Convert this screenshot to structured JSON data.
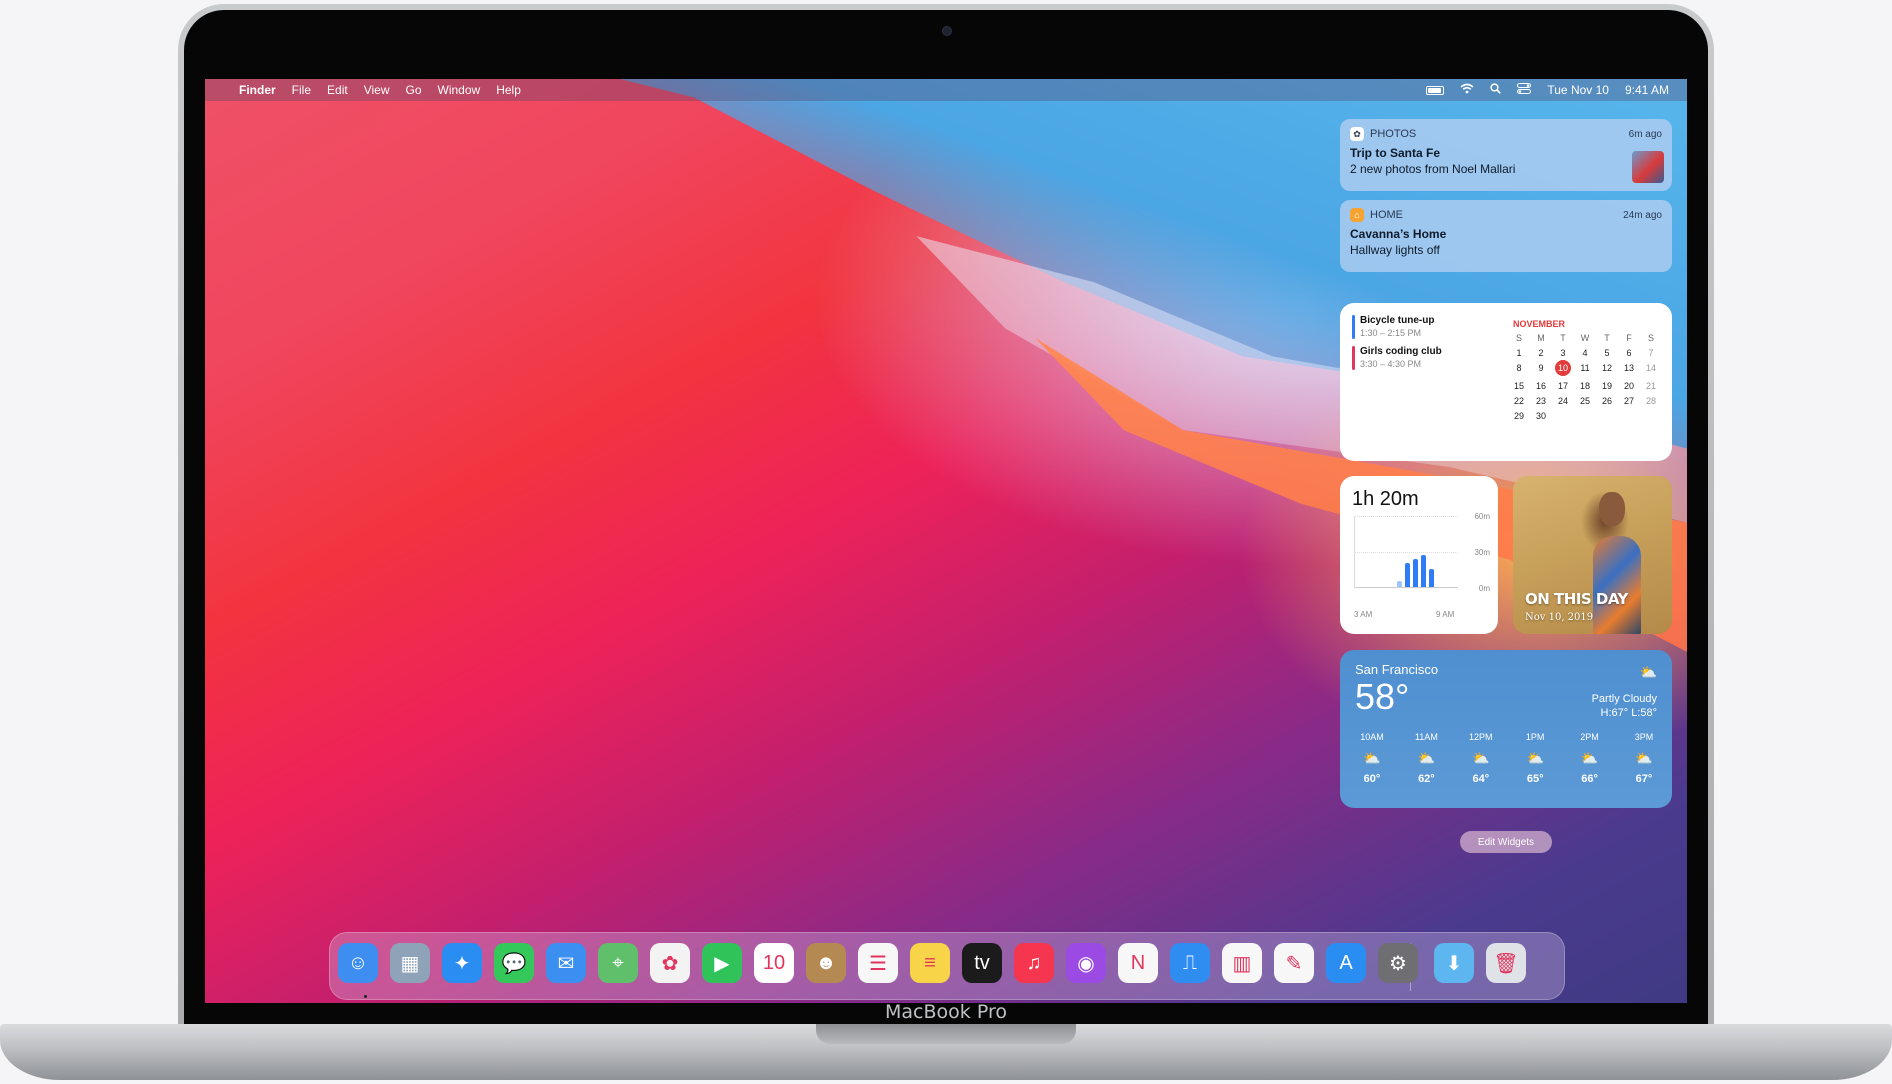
{
  "device_label": "MacBook Pro",
  "menubar": {
    "app_name": "Finder",
    "menus": [
      "File",
      "Edit",
      "View",
      "Go",
      "Window",
      "Help"
    ],
    "date": "Tue Nov 10",
    "time": "9:41 AM",
    "status_icons": [
      "battery-icon",
      "wifi-icon",
      "spotlight-icon",
      "control-center-icon"
    ]
  },
  "notifications": [
    {
      "app": "PHOTOS",
      "time": "6m ago",
      "title": "Trip to Santa Fe",
      "body": "2 new photos from Noel Mallari",
      "icon": "photos-icon"
    },
    {
      "app": "HOME",
      "time": "24m ago",
      "title": "Cavanna’s Home",
      "body": "Hallway lights off",
      "icon": "home-icon"
    }
  ],
  "calendar": {
    "events": [
      {
        "title": "Bicycle tune-up",
        "time": "1:30 – 2:15 PM",
        "color": "#2f7cf6"
      },
      {
        "title": "Girls coding club",
        "time": "3:30 – 4:30 PM",
        "color": "#e2355e"
      }
    ],
    "month": "NOVEMBER",
    "weekdays": [
      "S",
      "M",
      "T",
      "W",
      "T",
      "F",
      "S"
    ],
    "weeks": [
      [
        "1",
        "2",
        "3",
        "4",
        "5",
        "6",
        "7"
      ],
      [
        "8",
        "9",
        "10",
        "11",
        "12",
        "13",
        "14"
      ],
      [
        "15",
        "16",
        "17",
        "18",
        "19",
        "20",
        "21"
      ],
      [
        "22",
        "23",
        "24",
        "25",
        "26",
        "27",
        "28"
      ],
      [
        "29",
        "30",
        "",
        "",
        "",
        "",
        ""
      ]
    ],
    "today": "10"
  },
  "screen_time": {
    "total": "1h 20m",
    "y_labels": [
      "60m",
      "30m",
      "0m"
    ],
    "x_labels": [
      "3 AM",
      "9 AM"
    ]
  },
  "photo_widget": {
    "title": "ON THIS DAY",
    "date": "Nov 10, 2019"
  },
  "weather": {
    "city": "San Francisco",
    "temp": "58°",
    "condition": "Partly Cloudy",
    "hilo": "H:67° L:58°",
    "hours": [
      {
        "label": "10AM",
        "temp": "60°"
      },
      {
        "label": "11AM",
        "temp": "62°"
      },
      {
        "label": "12PM",
        "temp": "64°"
      },
      {
        "label": "1PM",
        "temp": "65°"
      },
      {
        "label": "2PM",
        "temp": "66°"
      },
      {
        "label": "3PM",
        "temp": "67°"
      }
    ]
  },
  "edit_widgets_label": "Edit Widgets",
  "dock": {
    "apps": [
      {
        "name": "finder-icon",
        "color": "#3d8ef0",
        "glyph": "☺"
      },
      {
        "name": "launchpad-icon",
        "color": "#8fa3b8",
        "glyph": "▦"
      },
      {
        "name": "safari-icon",
        "color": "#2a8df2",
        "glyph": "✦"
      },
      {
        "name": "messages-icon",
        "color": "#34c759",
        "glyph": "💬"
      },
      {
        "name": "mail-icon",
        "color": "#3a8ff0",
        "glyph": "✉"
      },
      {
        "name": "maps-icon",
        "color": "#5fbf6a",
        "glyph": "⌖"
      },
      {
        "name": "photos-icon",
        "color": "#f3f3f3",
        "glyph": "✿"
      },
      {
        "name": "facetime-icon",
        "color": "#30c35a",
        "glyph": "▶"
      },
      {
        "name": "calendar-icon",
        "color": "#ffffff",
        "glyph": "10"
      },
      {
        "name": "contacts-icon",
        "color": "#b58a52",
        "glyph": "☻"
      },
      {
        "name": "reminders-icon",
        "color": "#f7f7f7",
        "glyph": "☰"
      },
      {
        "name": "notes-icon",
        "color": "#f8d548",
        "glyph": "≡"
      },
      {
        "name": "tv-icon",
        "color": "#1b1b1b",
        "glyph": "tv"
      },
      {
        "name": "music-icon",
        "color": "#f6364f",
        "glyph": "♫"
      },
      {
        "name": "podcasts-icon",
        "color": "#9b4be3",
        "glyph": "◉"
      },
      {
        "name": "news-icon",
        "color": "#f7f7f7",
        "glyph": "N"
      },
      {
        "name": "keynote-icon",
        "color": "#2f8df1",
        "glyph": "⎍"
      },
      {
        "name": "numbers-icon",
        "color": "#f7f7f7",
        "glyph": "▥"
      },
      {
        "name": "pages-icon",
        "color": "#f7f7f7",
        "glyph": "✎"
      },
      {
        "name": "app-store-icon",
        "color": "#2a8df2",
        "glyph": "A"
      },
      {
        "name": "system-preferences-icon",
        "color": "#6e6e73",
        "glyph": "⚙"
      },
      {
        "name": "downloads-folder-icon",
        "color": "#5db6ef",
        "glyph": "⬇"
      },
      {
        "name": "trash-icon",
        "color": "#dfe2e6",
        "glyph": "🗑"
      }
    ]
  }
}
